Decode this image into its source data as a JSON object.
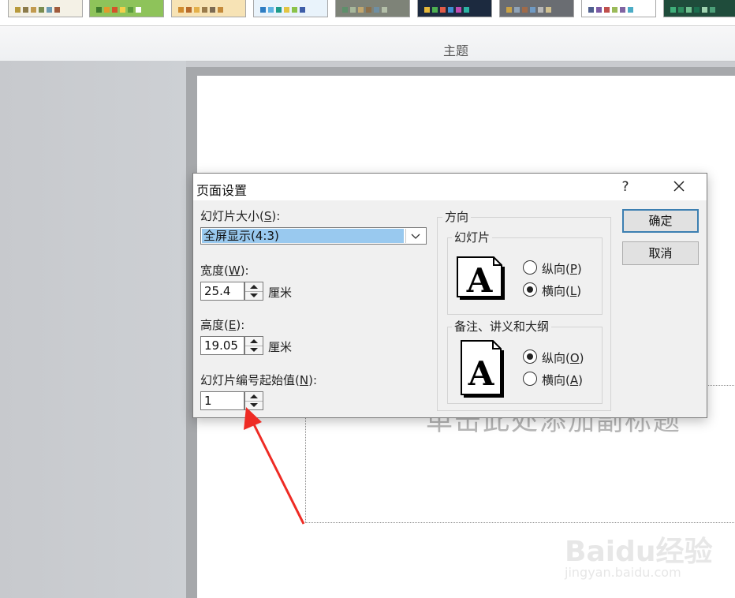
{
  "ribbon": {
    "group_label": "主题",
    "themes": [
      {
        "name": "theme-1",
        "bg": "#f4f1e6",
        "swatches": [
          "#b89a3c",
          "#8c7b4a",
          "#c29a4e",
          "#7a8c4f",
          "#6b9bb4",
          "#a05b3c"
        ]
      },
      {
        "name": "theme-2",
        "bg": "#8ec35a",
        "swatches": [
          "#3d7a2c",
          "#e09b2d",
          "#d4522a",
          "#f3d04b",
          "#5a9c3c",
          "#ffffff"
        ]
      },
      {
        "name": "theme-3",
        "bg": "#f7e3b5",
        "swatches": [
          "#d08b2e",
          "#b86a2b",
          "#e4b04a",
          "#9a7b4a",
          "#7c6a52",
          "#c48a3a"
        ]
      },
      {
        "name": "theme-4",
        "bg": "#e9f3fb",
        "swatches": [
          "#2e7dc3",
          "#5fb2e3",
          "#1e9c8a",
          "#e3c543",
          "#8ac34a",
          "#3d5da8"
        ]
      },
      {
        "name": "theme-5",
        "bg": "#7e8378",
        "swatches": [
          "#5e8f6b",
          "#a7b89b",
          "#c2a76f",
          "#8c6f4a",
          "#6f8fa3",
          "#b3bfa8"
        ]
      },
      {
        "name": "theme-6",
        "bg": "#1c2a3f",
        "swatches": [
          "#e5b83a",
          "#4caf50",
          "#e05a47",
          "#3c8fd1",
          "#c04bb1",
          "#2bb3a3"
        ]
      },
      {
        "name": "theme-7",
        "bg": "#6a6d72",
        "swatches": [
          "#c9a247",
          "#8fa3b8",
          "#a06b4a",
          "#6f9ac4",
          "#b8b8b8",
          "#d0c090"
        ]
      },
      {
        "name": "theme-8",
        "bg": "#ffffff",
        "swatches": [
          "#4f5f8f",
          "#7c5ba6",
          "#c0504d",
          "#9bbb59",
          "#8064a2",
          "#4bacc6"
        ]
      },
      {
        "name": "theme-9",
        "bg": "#1f4c3b",
        "swatches": [
          "#3fae7a",
          "#2d8c5e",
          "#6fc08f",
          "#1c6e4f",
          "#9fd3b0",
          "#4c9f78"
        ]
      }
    ]
  },
  "slide": {
    "placeholder_text": "单击此处添加副标题"
  },
  "watermark": {
    "logo": "Baidu经验",
    "url": "jingyan.baidu.com"
  },
  "dialog": {
    "title": "页面设置",
    "help": "?",
    "slide_size": {
      "label_pre": "幻灯片大小(",
      "key": "S",
      "label_post": "):",
      "value": "全屏显示(4:3)"
    },
    "width": {
      "label_pre": "宽度(",
      "key": "W",
      "label_post": "):",
      "value": "25.4",
      "unit": "厘米"
    },
    "height": {
      "label_pre": "高度(",
      "key": "E",
      "label_post": "):",
      "value": "19.05",
      "unit": "厘米"
    },
    "numbering": {
      "label_pre": "幻灯片编号起始值(",
      "key": "N",
      "label_post": "):",
      "value": "1"
    },
    "orientation": {
      "label": "方向",
      "slides": {
        "label": "幻灯片",
        "portrait": {
          "pre": "纵向(",
          "key": "P",
          "post": ")",
          "checked": false
        },
        "landscape": {
          "pre": "横向(",
          "key": "L",
          "post": ")",
          "checked": true
        }
      },
      "notes": {
        "label": "备注、讲义和大纲",
        "portrait": {
          "pre": "纵向(",
          "key": "O",
          "post": ")",
          "checked": true
        },
        "landscape": {
          "pre": "横向(",
          "key": "A",
          "post": ")",
          "checked": false
        }
      }
    },
    "ok_label": "确定",
    "cancel_label": "取消"
  },
  "annotation": {
    "arrow_color": "#ee2b24"
  }
}
